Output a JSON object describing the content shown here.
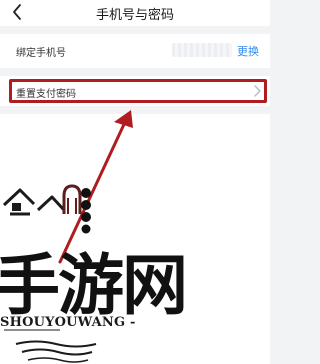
{
  "header": {
    "title": "手机号与密码",
    "back_icon": "chevron-left-icon"
  },
  "phone_row": {
    "label": "绑定手机号",
    "action": "更换"
  },
  "reset_row": {
    "label": "重置支付密码",
    "icon": "chevron-right-icon"
  },
  "watermark": {
    "logo_text": "手游网",
    "caption": "SHOUYOUWANG -"
  },
  "colors": {
    "accent_link": "#2f8cf0",
    "highlight": "#b01c20",
    "background": "#f2f3f5"
  }
}
